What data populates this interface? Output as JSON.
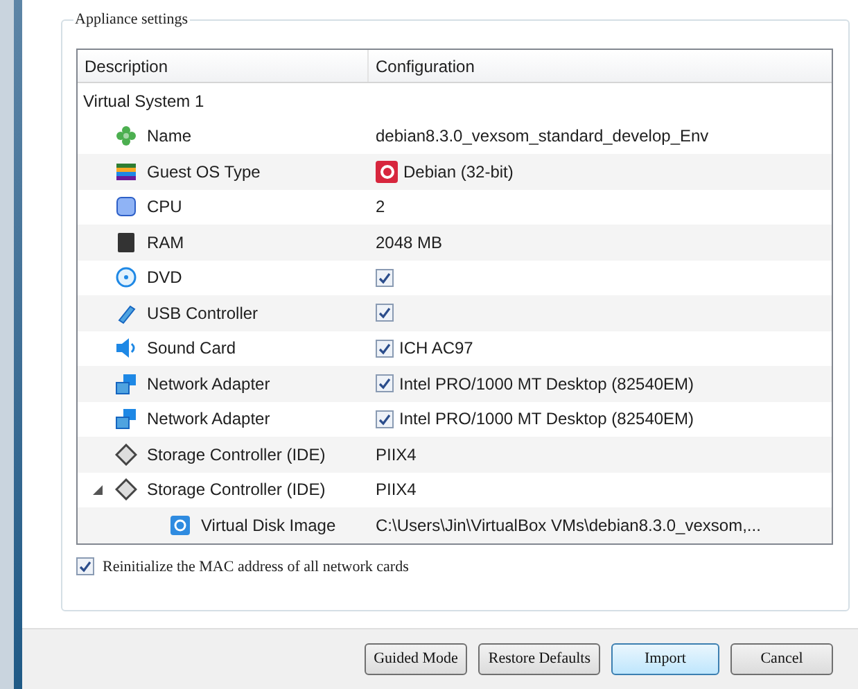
{
  "group_title": "Appliance settings",
  "table": {
    "columns": [
      "Description",
      "Configuration"
    ],
    "rows": [
      {
        "description": "Virtual System 1",
        "children": [
          {
            "kind": "name",
            "description": "Name",
            "value": "debian8.3.0_vexsom_standard_develop_Env"
          },
          {
            "kind": "os",
            "description": "Guest OS Type",
            "value": "Debian (32-bit)"
          },
          {
            "kind": "cpu",
            "description": "CPU",
            "value": "2"
          },
          {
            "kind": "ram",
            "description": "RAM",
            "value": "2048 MB"
          },
          {
            "kind": "dvd",
            "description": "DVD",
            "checked": true
          },
          {
            "kind": "usb",
            "description": "USB Controller",
            "checked": true
          },
          {
            "kind": "sound",
            "description": "Sound Card",
            "checked": true,
            "value": "ICH AC97"
          },
          {
            "kind": "network",
            "description": "Network Adapter",
            "checked": true,
            "value": "Intel PRO/1000 MT Desktop (82540EM)"
          },
          {
            "kind": "network",
            "description": "Network Adapter",
            "checked": true,
            "value": "Intel PRO/1000 MT Desktop (82540EM)"
          },
          {
            "kind": "storage",
            "description": "Storage Controller (IDE)",
            "value": "PIIX4"
          },
          {
            "kind": "storage",
            "description": "Storage Controller (IDE)",
            "value": "PIIX4",
            "expanded": true,
            "children": [
              {
                "kind": "disk",
                "description": "Virtual Disk Image",
                "value": "C:\\Users\\Jin\\VirtualBox VMs\\debian8.3.0_vexsom,..."
              }
            ]
          }
        ]
      }
    ]
  },
  "reinit_mac": {
    "label": "Reinitialize the MAC address of all network cards",
    "checked": true
  },
  "buttons": [
    {
      "label": "Guided Mode",
      "default": false
    },
    {
      "label": "Restore Defaults",
      "default": false
    },
    {
      "label": "Import",
      "default": true
    },
    {
      "label": "Cancel",
      "default": false
    }
  ]
}
